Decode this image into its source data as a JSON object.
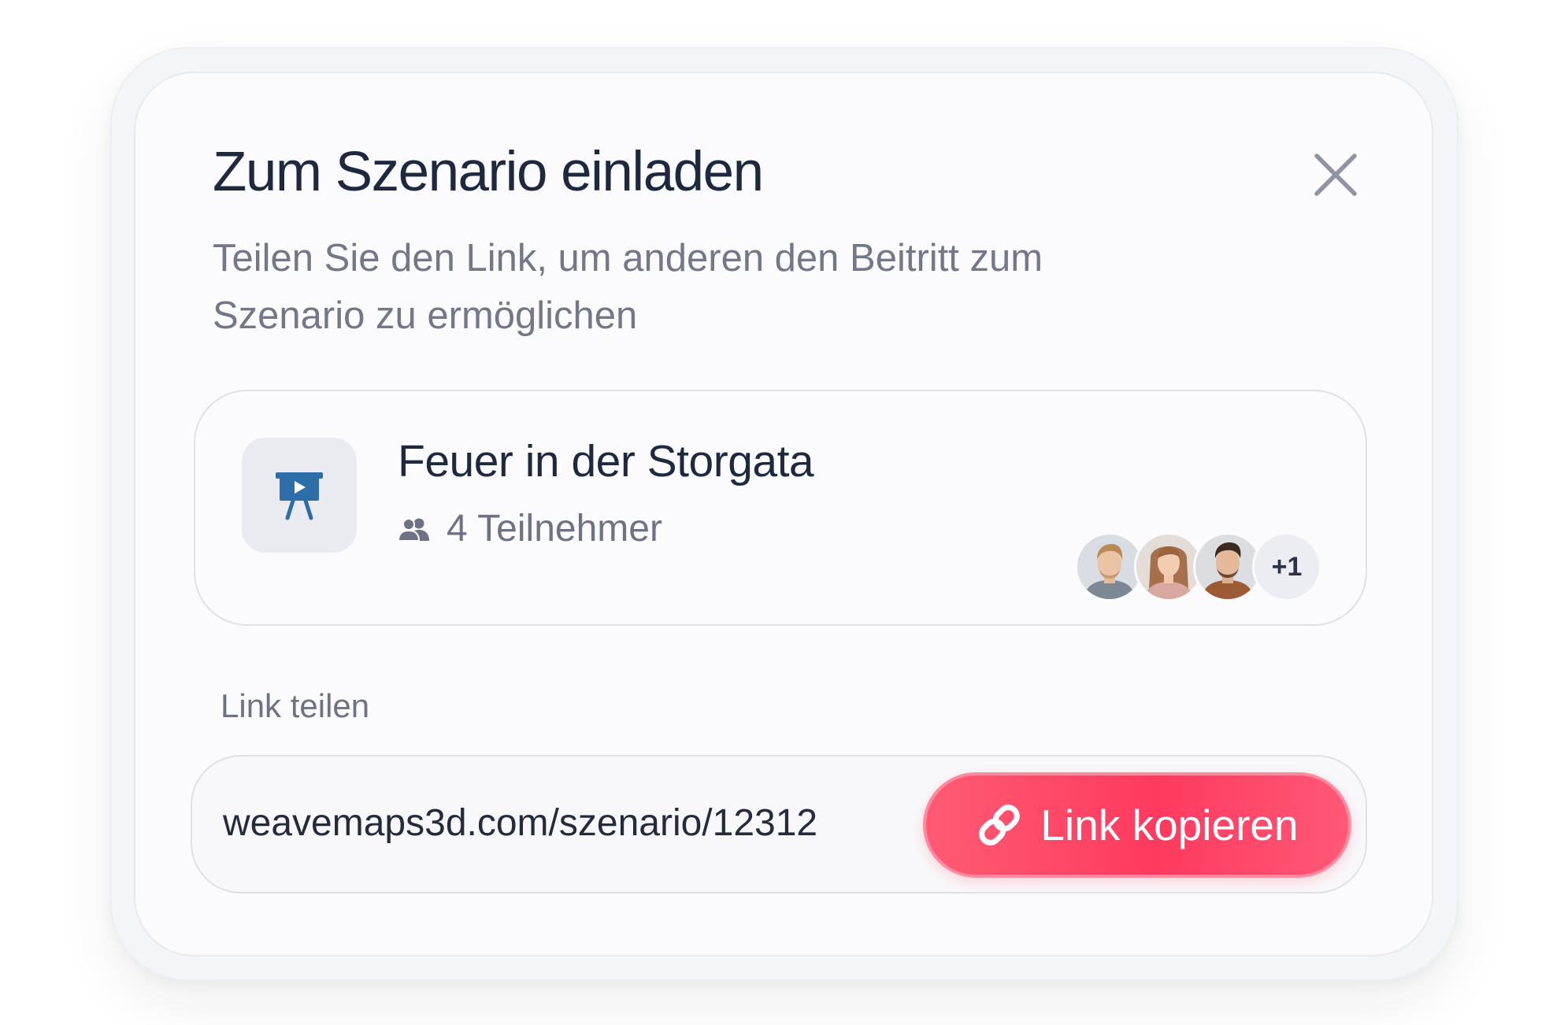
{
  "dialog": {
    "title": "Zum Szenario einladen",
    "subtitle": "Teilen Sie den Link, um anderen den Beitritt zum Szenario zu ermöglichen",
    "close_icon": "close-icon"
  },
  "scenario": {
    "icon": "presentation-icon",
    "name": "Feuer in der Storgata",
    "participants_icon": "users-icon",
    "participants_label": "4 Teilnehmer",
    "avatars": [
      "avatar-1",
      "avatar-2",
      "avatar-3"
    ],
    "more_count": "+1"
  },
  "share": {
    "label": "Link teilen",
    "url": "weavemaps3d.com/szenario/12312",
    "button_icon": "link-icon",
    "button_label": "Link kopieren"
  },
  "colors": {
    "title": "#1e2940",
    "muted": "#737789",
    "accent": "#ff3a5f",
    "scenario_icon": "#2d6ea8"
  }
}
